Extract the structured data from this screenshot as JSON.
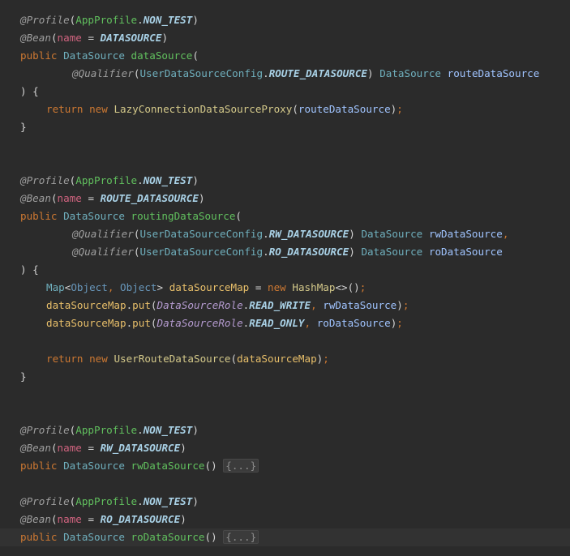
{
  "lines": [
    "@Profile(AppProfile.NON_TEST)",
    "@Bean(name = DATASOURCE)",
    "public DataSource dataSource(",
    "@Qualifier(UserDataSourceConfig.ROUTE_DATASOURCE) DataSource routeDataSource",
    ") {",
    "return new LazyConnectionDataSourceProxy(routeDataSource);",
    "}",
    "",
    "",
    "@Profile(AppProfile.NON_TEST)",
    "@Bean(name = ROUTE_DATASOURCE)",
    "public DataSource routingDataSource(",
    "@Qualifier(UserDataSourceConfig.RW_DATASOURCE) DataSource rwDataSource,",
    "@Qualifier(UserDataSourceConfig.RO_DATASOURCE) DataSource roDataSource",
    ") {",
    "Map<Object, Object> dataSourceMap = new HashMap<>();",
    "dataSourceMap.put(DataSourceRole.READ_WRITE, rwDataSource);",
    "dataSourceMap.put(DataSourceRole.READ_ONLY, roDataSource);",
    "",
    "return new UserRouteDataSource(dataSourceMap);",
    "}",
    "",
    "",
    "@Profile(AppProfile.NON_TEST)",
    "@Bean(name = RW_DATASOURCE)",
    "public DataSource rwDataSource() {...}",
    "",
    "@Profile(AppProfile.NON_TEST)",
    "@Bean(name = RO_DATASOURCE)",
    "public DataSource roDataSource() {...}"
  ],
  "tokens": {
    "at": "@",
    "profile": "Profile",
    "bean": "Bean",
    "qualifier": "Qualifier",
    "app_profile": "AppProfile",
    "non_test": "NON_TEST",
    "name": "name",
    "datasource_const": "DATASOURCE",
    "route_datasource_const": "ROUTE_DATASOURCE",
    "rw_datasource_const": "RW_DATASOURCE",
    "ro_datasource_const": "RO_DATASOURCE",
    "public": "public",
    "return": "return",
    "new": "new",
    "datasource_type": "DataSource",
    "user_ds_config": "UserDataSourceConfig",
    "ds_method": "dataSource",
    "routing_ds_method": "routingDataSource",
    "rw_ds_method": "rwDataSource",
    "ro_ds_method": "roDataSource",
    "route_ds_param": "routeDataSource",
    "rw_ds_param": "rwDataSource",
    "ro_ds_param": "roDataSource",
    "lazy_proxy": "LazyConnectionDataSourceProxy",
    "map": "Map",
    "object": "Object",
    "ds_map": "dataSourceMap",
    "hashmap": "HashMap",
    "put": "put",
    "ds_role": "DataSourceRole",
    "read_write": "READ_WRITE",
    "read_only": "READ_ONLY",
    "user_route_ds": "UserRouteDataSource",
    "fold": "{...}"
  },
  "colors": {
    "background": "#2b2b2b",
    "current_line": "#323232",
    "keyword": "#cc7832",
    "annotation": "#bbb529",
    "method": "#61c05e",
    "constant": "#a9d1e6",
    "parameter": "#a0c4ff",
    "attribute": "#d0637f",
    "enum": "#b59bd0"
  }
}
